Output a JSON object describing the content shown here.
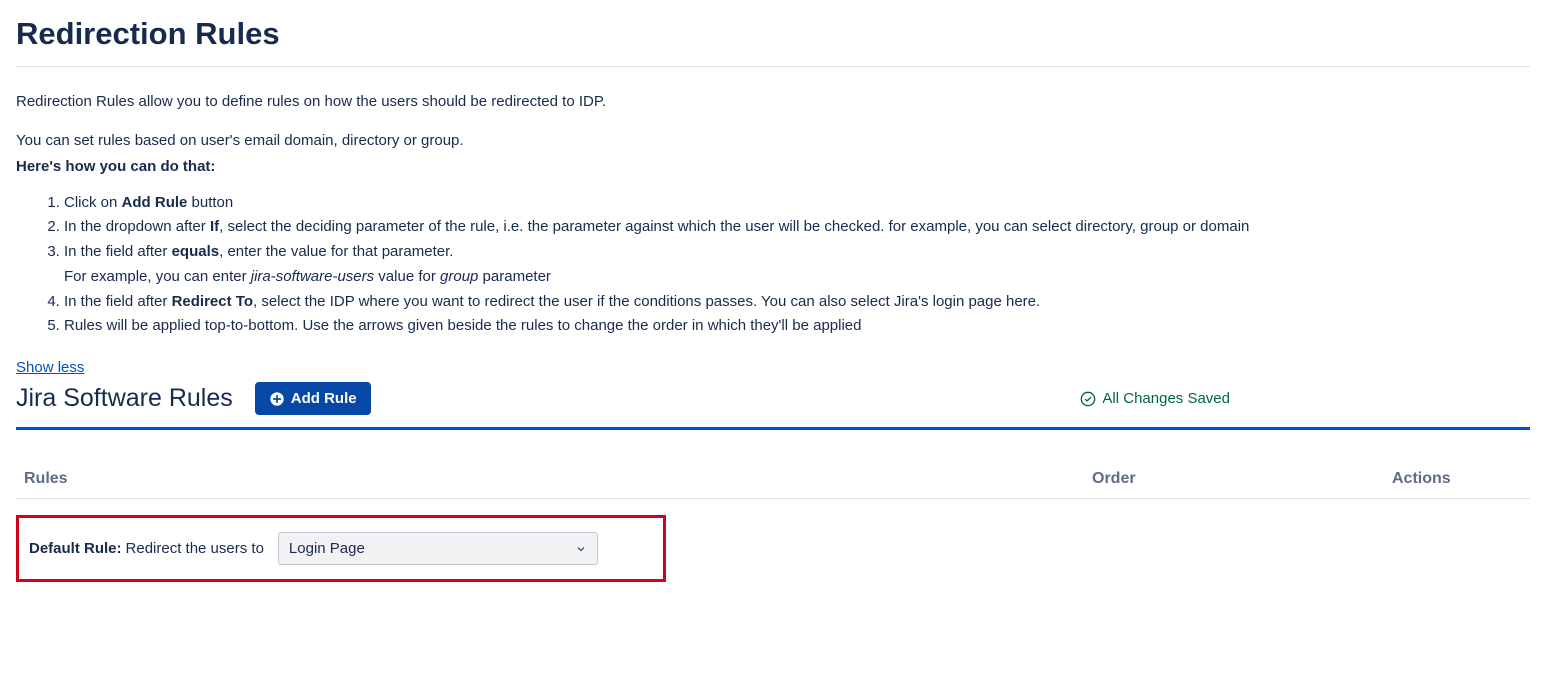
{
  "page": {
    "title": "Redirection Rules"
  },
  "intro": {
    "paragraph1": "Redirection Rules allow you to define rules on how the users should be redirected to IDP.",
    "paragraph2": "You can set rules based on user's email domain, directory or group.",
    "howto_label": "Here's how you can do that:",
    "steps": {
      "s1_a": "Click on ",
      "s1_b": "Add Rule",
      "s1_c": " button",
      "s2_a": "In the dropdown after ",
      "s2_b": "If",
      "s2_c": ", select the deciding parameter of the rule, i.e. the parameter against which the user will be checked. for example, you can select directory, group or domain",
      "s3_a": "In the field after ",
      "s3_b": "equals",
      "s3_c": ", enter the value for that parameter.",
      "s3_d": "For example, you can enter ",
      "s3_e": "jira-software-users",
      "s3_f": " value for ",
      "s3_g": "group",
      "s3_h": " parameter",
      "s4_a": "In the field after ",
      "s4_b": "Redirect To",
      "s4_c": ", select the IDP where you want to redirect the user if the conditions passes. You can also select Jira's login page here.",
      "s5": "Rules will be applied top-to-bottom. Use the arrows given beside the rules to change the order in which they'll be applied"
    },
    "show_less": "Show less"
  },
  "section": {
    "title": "Jira Software Rules",
    "add_rule_label": "Add Rule",
    "saved_status": "All Changes Saved"
  },
  "table": {
    "headers": {
      "rules": "Rules",
      "order": "Order",
      "actions": "Actions"
    }
  },
  "default_rule": {
    "label": "Default Rule:",
    "text": "Redirect the users to",
    "selected": "Login Page"
  }
}
